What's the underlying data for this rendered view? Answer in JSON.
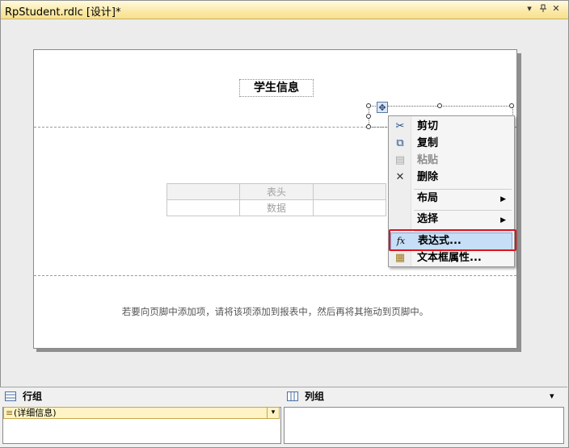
{
  "window": {
    "title": "RpStudent.rdlc [设计]*"
  },
  "titlebar_buttons": {
    "dropdown": "▾",
    "pin": "ᛁ",
    "close": "✕"
  },
  "report": {
    "title": "学生信息",
    "table": {
      "header_cell": "表头",
      "data_cell": "数据"
    },
    "footer_hint": "若要向页脚中添加项，请将该项添加到报表中，然后再将其拖动到页脚中。"
  },
  "context_menu": {
    "items": [
      {
        "label": "剪切",
        "icon": "✂",
        "disabled": false
      },
      {
        "label": "复制",
        "icon": "⧉",
        "disabled": false
      },
      {
        "label": "粘贴",
        "icon": "▤",
        "disabled": true
      },
      {
        "label": "删除",
        "icon": "✕",
        "disabled": false
      },
      {
        "label": "布局",
        "icon": "",
        "submenu": true
      },
      {
        "label": "选择",
        "icon": "",
        "submenu": true
      },
      {
        "label": "表达式...",
        "icon": "fx",
        "highlighted": true
      },
      {
        "label": "文本框属性...",
        "icon": "▦",
        "disabled": false
      }
    ],
    "submenu_arrow": "▶"
  },
  "bottom_panes": {
    "row_groups": {
      "label": "行组",
      "item": "(详细信息)",
      "dropdown": "▾"
    },
    "column_groups": {
      "label": "列组",
      "dropdown": "▾"
    }
  }
}
